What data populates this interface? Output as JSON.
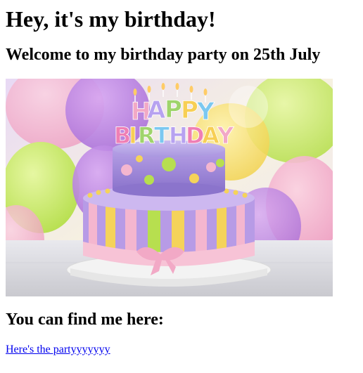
{
  "page": {
    "heading": "Hey, it's my birthday!",
    "subheading": "Welcome to my birthday party on 25th July",
    "find_heading": "You can find me here:",
    "link_text": "Here's the partyyyyyyy"
  },
  "image": {
    "subject": "birthday-cake-image",
    "candle_text": "HAPPY BIRTHDAY",
    "colors": {
      "link": "#0000ee",
      "cake_purple": "#9a7fd1",
      "cake_pink": "#f4b6cf",
      "cake_yellow": "#f5d35a"
    }
  }
}
